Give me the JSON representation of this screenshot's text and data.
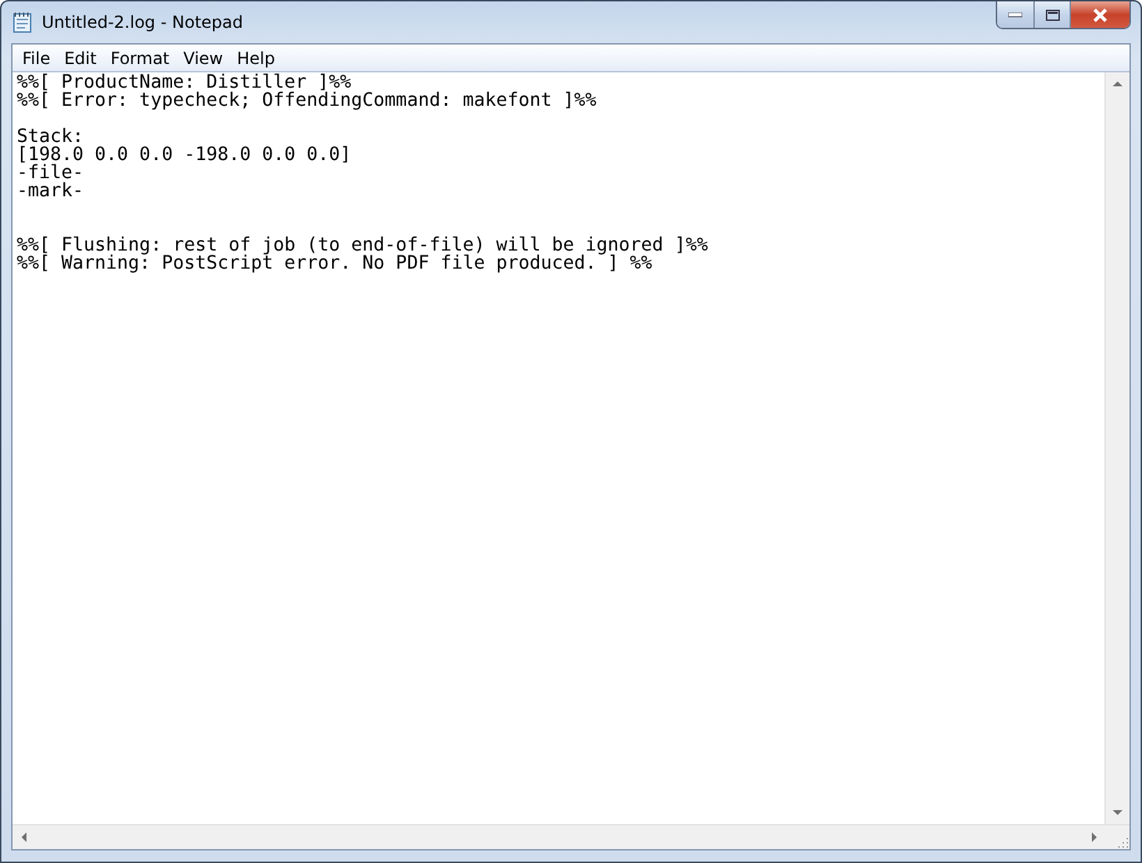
{
  "window": {
    "title": "Untitled-2.log - Notepad"
  },
  "menu": [
    {
      "label": "File"
    },
    {
      "label": "Edit"
    },
    {
      "label": "Format"
    },
    {
      "label": "View"
    },
    {
      "label": "Help"
    }
  ],
  "document": {
    "text": "%%[ ProductName: Distiller ]%%\n%%[ Error: typecheck; OffendingCommand: makefont ]%%\n\nStack:\n[198.0 0.0 0.0 -198.0 0.0 0.0]\n-file-\n-mark-\n\n\n%%[ Flushing: rest of job (to end-of-file) will be ignored ]%%\n%%[ Warning: PostScript error. No PDF file produced. ] %%"
  }
}
